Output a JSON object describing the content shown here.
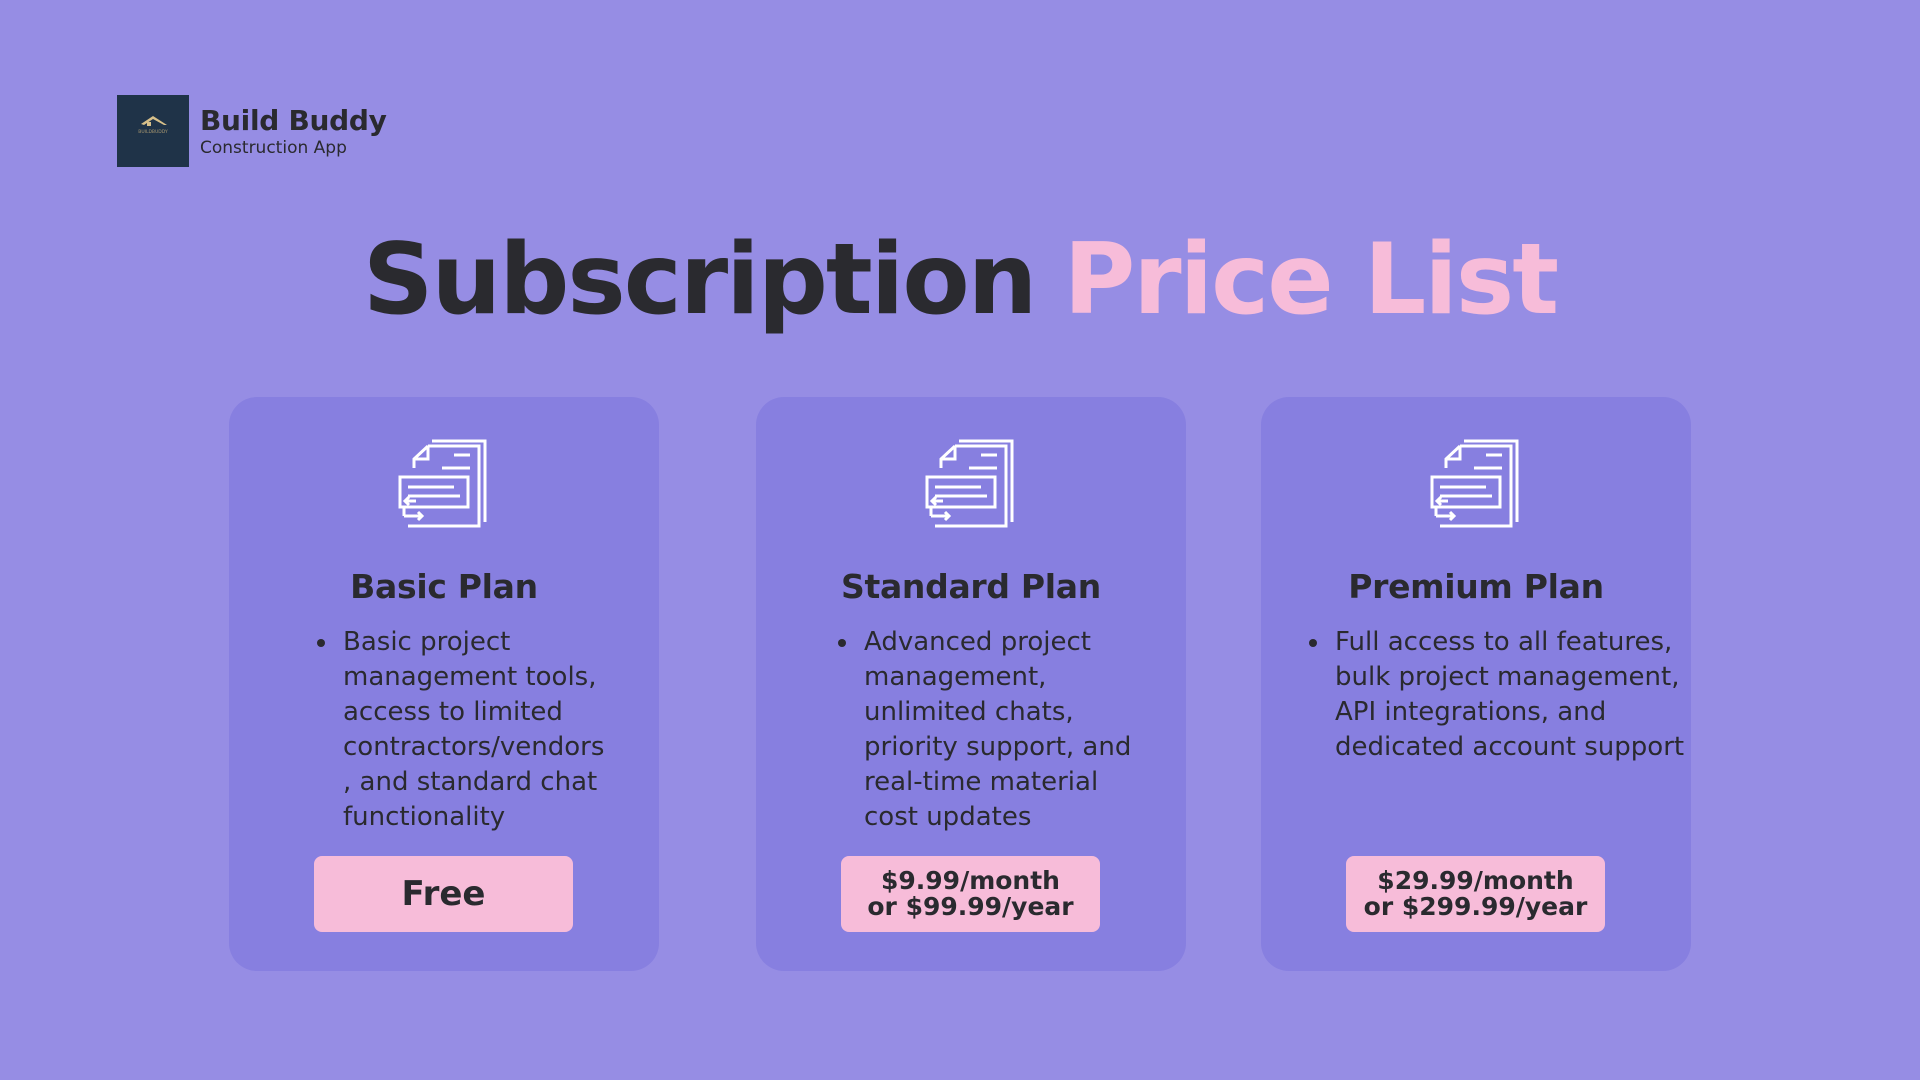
{
  "brand": {
    "name": "Build Buddy",
    "subtitle": "Construction App",
    "logo_text": "BUILDBUDDY"
  },
  "headline": {
    "part1": "Subscription",
    "part2": "Price List"
  },
  "colors": {
    "background": "#968de4",
    "card": "#877fe0",
    "accent_pink": "#f7bcd9",
    "text_dark": "#2a2a2f",
    "logo_bg": "#1f3348"
  },
  "plans": [
    {
      "icon": "invoice-document-icon",
      "title": "Basic Plan",
      "description": "Basic project management tools, access to limited contractors/vendors, and standard chat functionality",
      "price": "Free"
    },
    {
      "icon": "invoice-document-icon",
      "title": "Standard Plan",
      "description": "Advanced project management, unlimited chats, priority support, and real-time material cost updates",
      "price": "$9.99/month\nor $99.99/year"
    },
    {
      "icon": "invoice-document-icon",
      "title": "Premium Plan",
      "description": "Full access to all features, bulk project management, API integrations, and dedicated account support",
      "price": "$29.99/month\nor $299.99/year"
    }
  ]
}
